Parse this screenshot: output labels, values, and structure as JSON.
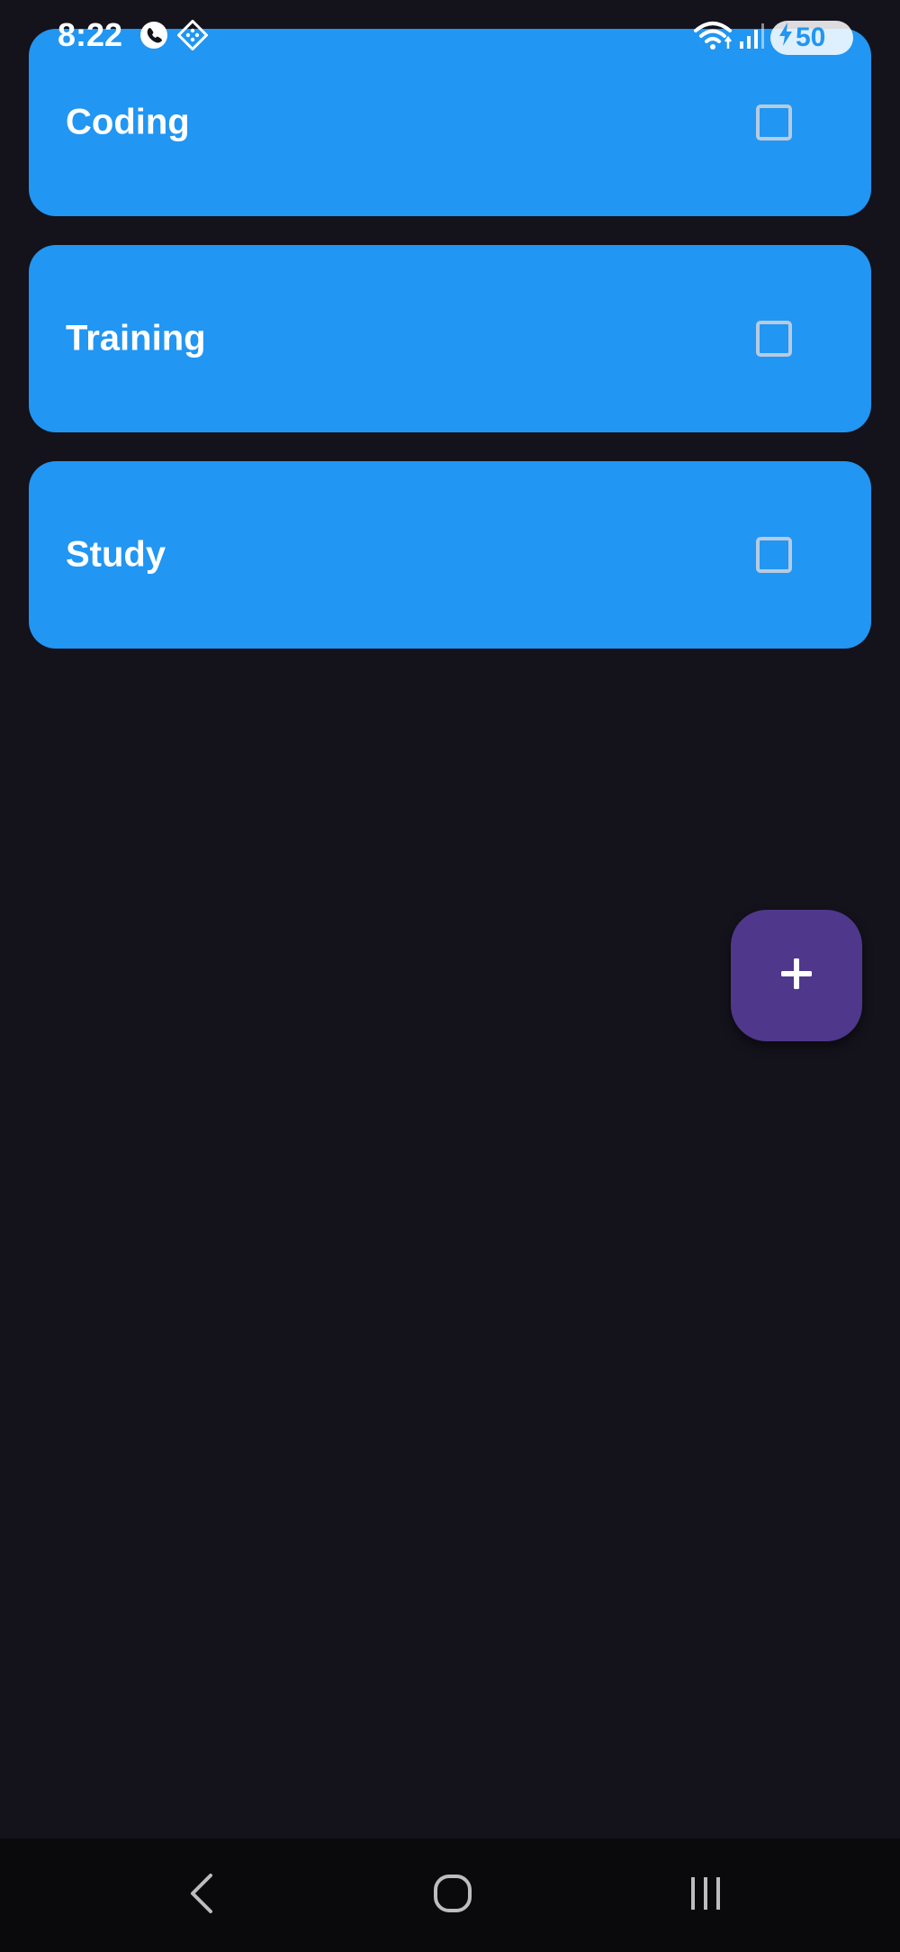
{
  "status_bar": {
    "time": "8:22",
    "battery_level": "50",
    "icons": [
      "call-app-icon",
      "grid-app-icon",
      "wifi-icon",
      "signal-icon",
      "battery-charging-icon"
    ]
  },
  "tasks": [
    {
      "title": "Coding",
      "checked": false
    },
    {
      "title": "Training",
      "checked": false
    },
    {
      "title": "Study",
      "checked": false
    }
  ],
  "fab": {
    "icon": "plus-icon"
  },
  "nav_bar": {
    "icons": [
      "back-icon",
      "home-icon",
      "recents-icon"
    ]
  },
  "colors": {
    "background": "#14121b",
    "card": "#2196f3",
    "fab": "#4f378b",
    "nav_bar": "#0a0a0c"
  }
}
